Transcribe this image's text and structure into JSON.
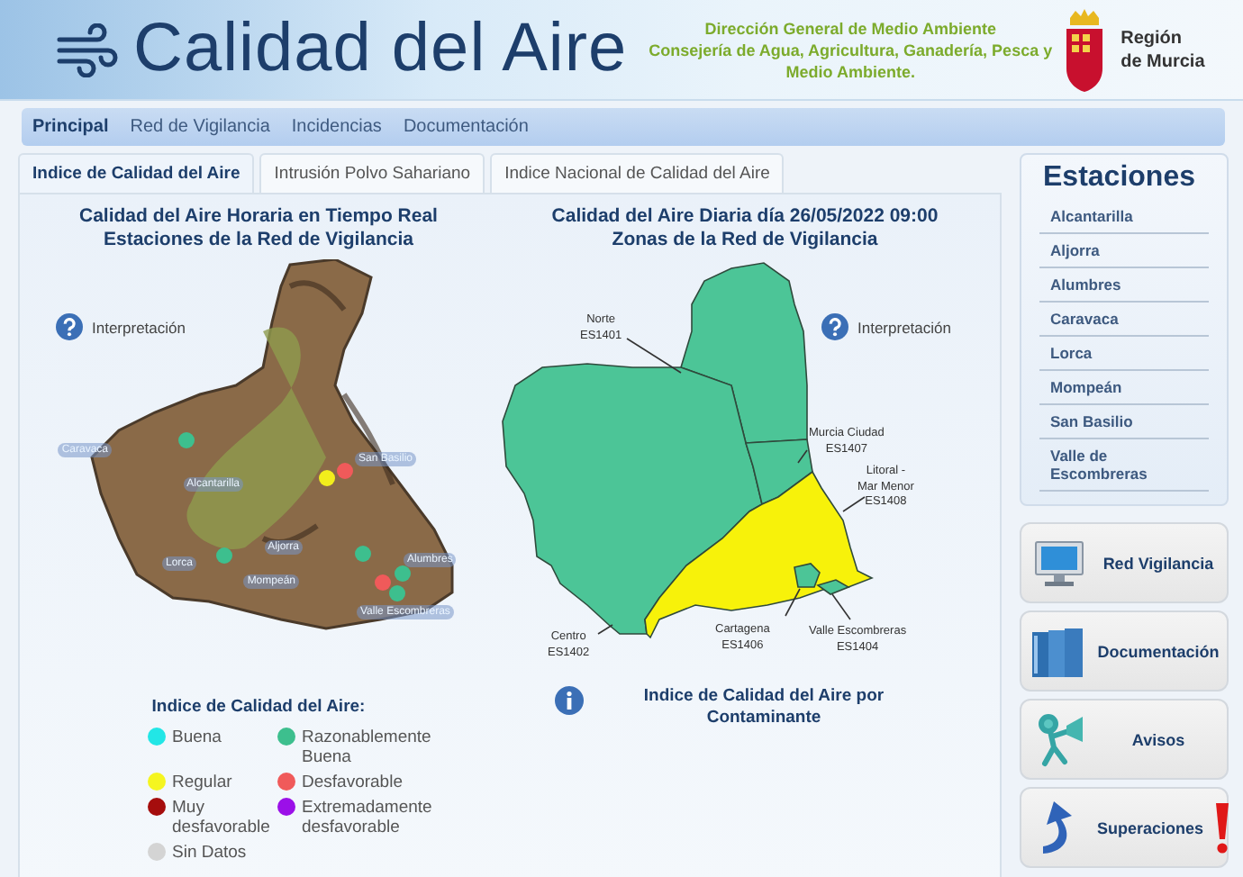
{
  "header": {
    "title": "Calidad del Aire",
    "department_lines": [
      "Dirección General de Medio Ambiente",
      "Consejería de Agua, Agricultura, Ganadería, Pesca y",
      "Medio Ambiente."
    ],
    "region_lines": [
      "Región",
      "de Murcia"
    ]
  },
  "nav": [
    {
      "label": "Principal",
      "selected": true
    },
    {
      "label": "Red de Vigilancia",
      "selected": false
    },
    {
      "label": "Incidencias",
      "selected": false
    },
    {
      "label": "Documentación",
      "selected": false
    }
  ],
  "tabs": [
    {
      "label": "Indice de Calidad del Aire",
      "selected": true
    },
    {
      "label": "Intrusión Polvo Sahariano",
      "selected": false
    },
    {
      "label": "Indice Nacional de Calidad del Aire",
      "selected": false
    }
  ],
  "realtime": {
    "title_lines": [
      "Calidad del Aire Horaria en Tiempo Real",
      "Estaciones de la Red de Vigilancia"
    ],
    "help_link": "Interpretación",
    "stations": [
      {
        "name": "Caravaca",
        "color": "#3dbf8e"
      },
      {
        "name": "San Basilio",
        "color": "#f05a5a"
      },
      {
        "name": "Alcantarilla",
        "color": "#f2ee1c"
      },
      {
        "name": "Lorca",
        "color": "#3dbf8e"
      },
      {
        "name": "Aljorra",
        "color": "#3dbf8e"
      },
      {
        "name": "Alumbres",
        "color": "#3dbf8e"
      },
      {
        "name": "Mompeán",
        "color": "#f05a5a"
      },
      {
        "name": "Valle Escombreras",
        "color": "#3dbf8e"
      }
    ]
  },
  "daily": {
    "title_lines": [
      "Calidad del Aire Diaria día 26/05/2022 09:00",
      "Zonas de la Red de Vigilancia"
    ],
    "help_link": "Interpretación",
    "zones": [
      {
        "label_lines": [
          "Norte",
          "ES1401"
        ],
        "color": "#4cc597"
      },
      {
        "label_lines": [
          "Centro",
          "ES1402"
        ],
        "color": "#4cc597"
      },
      {
        "label_lines": [
          "Murcia Ciudad",
          "ES1407"
        ],
        "color": "#4cc597"
      },
      {
        "label_lines": [
          "Litoral -",
          "Mar Menor",
          "ES1408"
        ],
        "color": "#f7f20a"
      },
      {
        "label_lines": [
          "Cartagena",
          "ES1406"
        ],
        "color": "#4cc597"
      },
      {
        "label_lines": [
          "Valle Escombreras",
          "ES1404"
        ],
        "color": "#4cc597"
      }
    ],
    "pollutant_link": "Indice de Calidad del Aire por Contaminante"
  },
  "legend": {
    "title": "Indice de Calidad del Aire:",
    "items": [
      {
        "label": "Buena",
        "color": "#22e6e6"
      },
      {
        "label": "Razonablemente Buena",
        "color": "#3dbf8e"
      },
      {
        "label": "Regular",
        "color": "#f5f520"
      },
      {
        "label": "Desfavorable",
        "color": "#f05a5a"
      },
      {
        "label": "Muy desfavorable",
        "color": "#a50d0d"
      },
      {
        "label": "Extremadamente desfavorable",
        "color": "#9b10e8"
      },
      {
        "label": "Sin Datos",
        "color": "#d4d4d4"
      }
    ]
  },
  "stations_panel": {
    "title": "Estaciones",
    "items": [
      "Alcantarilla",
      "Aljorra",
      "Alumbres",
      "Caravaca",
      "Lorca",
      "Mompeán",
      "San Basilio",
      "Valle de Escombreras"
    ]
  },
  "buttons": [
    {
      "label": "Red Vigilancia",
      "kind": "network"
    },
    {
      "label": "Documentación",
      "kind": "documents"
    },
    {
      "label": "Avisos",
      "kind": "alerts"
    },
    {
      "label": "Superaciones",
      "kind": "exceedances"
    }
  ]
}
